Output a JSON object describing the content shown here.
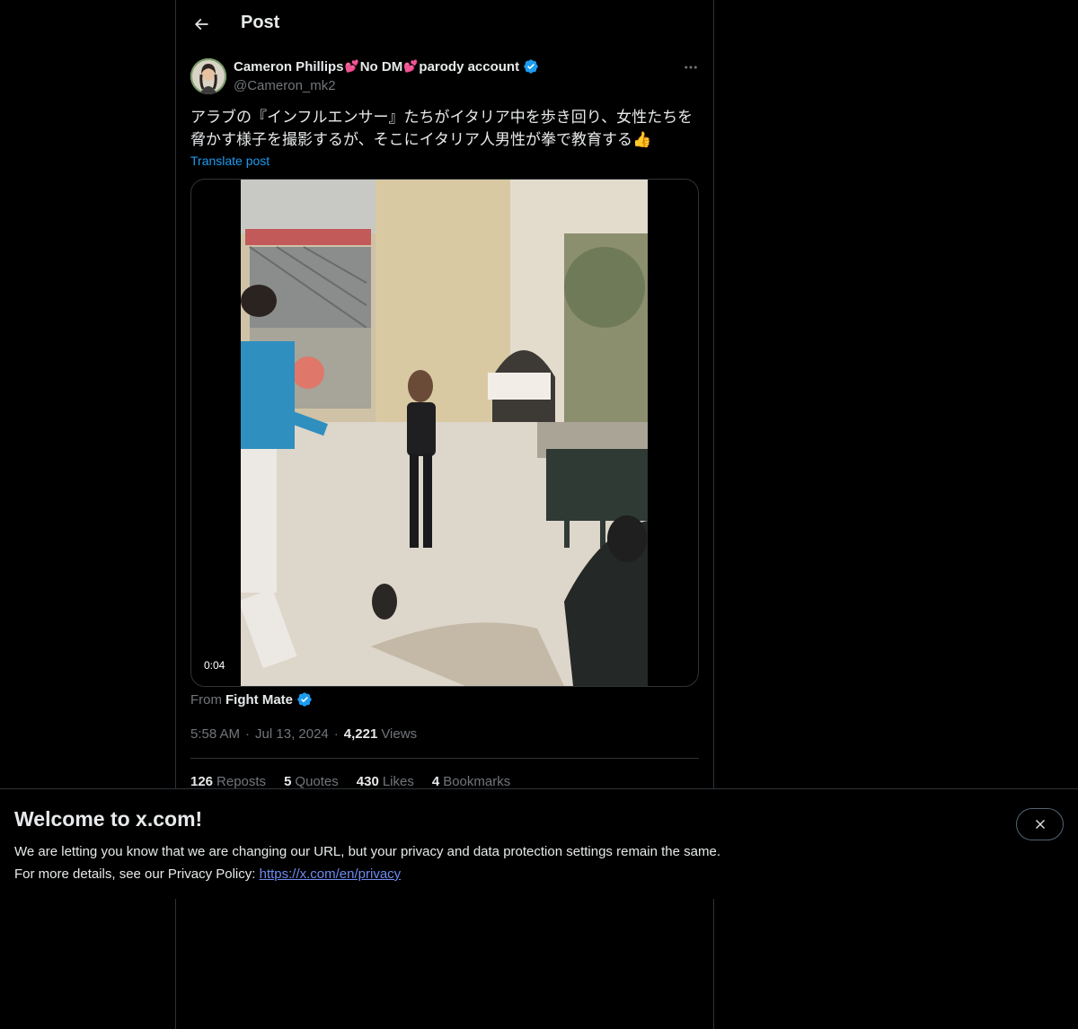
{
  "header": {
    "title": "Post"
  },
  "post": {
    "author": {
      "name_part1": "Cameron Phillips",
      "heart_emoji": "💕",
      "name_part2": "No DM",
      "name_part3": "parody account",
      "handle": "@Cameron_mk2",
      "verified": true
    },
    "text_line1": "アラブの『インフルエンサー』たちがイタリア中を歩き回り、女性たちを",
    "text_line2": "脅かす様子を撮影するが、そこにイタリア人男性が拳で教育する",
    "thumbs_emoji": "👍",
    "translate_label": "Translate post",
    "media": {
      "duration": "0:04"
    },
    "from_label": "From",
    "from_name": "Fight Mate",
    "time": "5:58 AM",
    "date": "Jul 13, 2024",
    "views_count": "4,221",
    "views_label": "Views",
    "stats": [
      {
        "count": "126",
        "label": "Reposts"
      },
      {
        "count": "5",
        "label": "Quotes"
      },
      {
        "count": "430",
        "label": "Likes"
      },
      {
        "count": "4",
        "label": "Bookmarks"
      }
    ]
  },
  "banner": {
    "title": "Welcome to x.com!",
    "line1": "We are letting you know that we are changing our URL, but your privacy and data protection settings remain the same.",
    "line2_prefix": "For more details, see our Privacy Policy:",
    "link": "https://x.com/en/privacy"
  },
  "colors": {
    "accent": "#1d9bf0",
    "link": "#6e8cf0",
    "muted": "#71767b",
    "border": "#2f3336"
  },
  "icons": [
    "back-arrow-icon",
    "verified-badge-icon",
    "more-dots-icon",
    "close-icon"
  ]
}
